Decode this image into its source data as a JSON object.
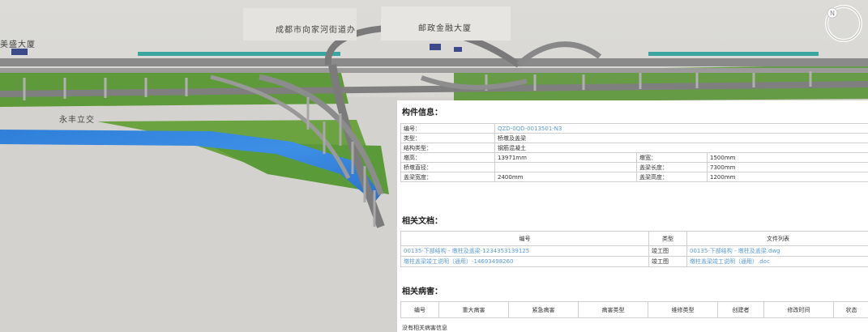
{
  "map": {
    "labels": {
      "building_left": "美盛大厦",
      "street": "成都市向家河街道办",
      "finance_tower": "邮政金融大厦",
      "interchange": "永丰立交"
    },
    "compass_letter": "N"
  },
  "panel": {
    "info_title": "构件信息：",
    "info_rows": [
      {
        "label": "编号：",
        "value": "QZD-0QD-0013501-N3"
      },
      {
        "label": "类型：",
        "value": "桥墩及盖梁"
      },
      {
        "label": "结构类型：",
        "value": "钢筋混凝土"
      }
    ],
    "pair_rows": [
      {
        "l1": "墩高：",
        "v1": "13971mm",
        "l2": "墩宽：",
        "v2": "1500mm"
      },
      {
        "l1": "桥墩直径：",
        "v1": "",
        "l2": "盖梁长度：",
        "v2": "7300mm"
      },
      {
        "l1": "盖梁宽度：",
        "v1": "2400mm",
        "l2": "盖梁高度：",
        "v2": "1200mm"
      }
    ],
    "docs_title": "相关文档：",
    "docs_headers": {
      "code": "编号",
      "type": "类型",
      "files": "文件列表"
    },
    "docs_rows": [
      {
        "code": "00135-下部结构 - 墩柱及盖梁-1234353139125",
        "type": "竣工图",
        "files": "00135-下部结构 - 墩柱及盖梁.dwg"
      },
      {
        "code": "墩柱盖梁竣工说明（通用）-14693498260",
        "type": "竣工图",
        "files": "墩柱盖梁竣工说明（通用）.doc"
      }
    ],
    "disease_title": "相关病害：",
    "disease_headers": [
      "编号",
      "重大病害",
      "紧急病害",
      "病害类型",
      "维修类型",
      "创建者",
      "修改时间",
      "状态"
    ],
    "no_disease": "没有相关病害信息"
  }
}
